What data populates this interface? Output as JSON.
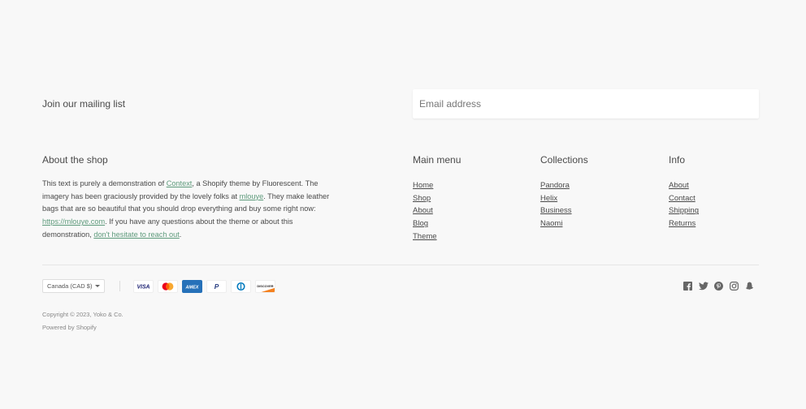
{
  "mailing": {
    "label": "Join our mailing list",
    "email_placeholder": "Email address",
    "email_value": ""
  },
  "about": {
    "title": "About the shop",
    "text_1": "This text is purely a demonstration of ",
    "link_context": "Context",
    "text_2": ", a Shopify theme by Fluorescent. The imagery has been graciously provided by the lovely folks at ",
    "link_mlouye": "mlouye",
    "text_3": ". They make leather bags that are so beautiful that you should drop everything and buy some right now: ",
    "link_url": "https://mlouye.com",
    "text_4": ". If you have any questions about the theme or about this demonstration, ",
    "link_contact": "don't hesitate to reach out",
    "text_5": "."
  },
  "main_menu": {
    "title": "Main menu",
    "items": [
      "Home",
      "Shop",
      "About",
      "Blog",
      "Theme"
    ]
  },
  "collections": {
    "title": "Collections",
    "items": [
      "Pandora",
      "Helix",
      "Business",
      "Naomi"
    ]
  },
  "info": {
    "title": "Info",
    "items": [
      "About",
      "Contact",
      "Shipping",
      "Returns"
    ]
  },
  "footer": {
    "currency": "Canada (CAD $)",
    "payment_icons": [
      "visa-icon",
      "mastercard-icon",
      "amex-icon",
      "paypal-icon",
      "diners-club-icon",
      "discover-icon"
    ],
    "payment_labels": {
      "visa": "VISA",
      "amex": "AMEX",
      "paypal": "P",
      "discover": "DISCOVER"
    },
    "copyright": "Copyright © 2023, Yoko & Co.",
    "powered_by": "Powered by Shopify",
    "social_icons": [
      "facebook-icon",
      "twitter-icon",
      "pinterest-icon",
      "instagram-icon",
      "snapchat-icon"
    ]
  },
  "colors": {
    "background": "#f8f8f8",
    "link_accent": "#5d9a7b",
    "text": "#4a4a4a",
    "amex_blue": "#2671b9",
    "visa_navy": "#1a1f71"
  }
}
